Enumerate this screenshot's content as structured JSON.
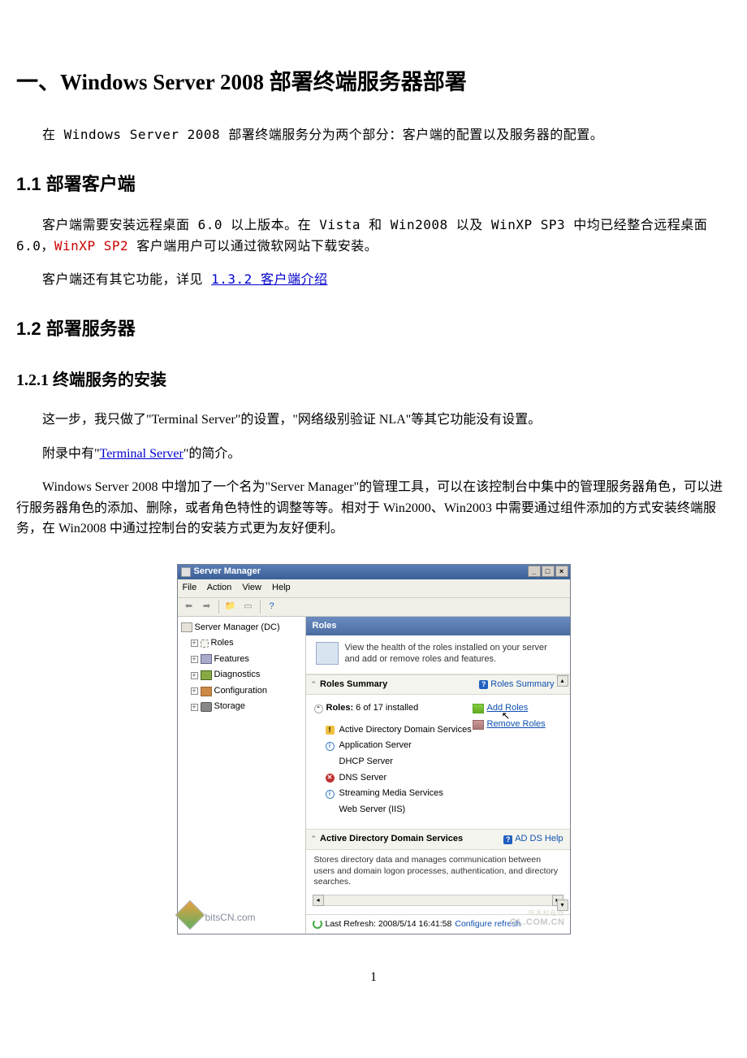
{
  "doc": {
    "h1_prefix": "一、",
    "h1_sans": "Windows Server 2008 ",
    "h1_suffix": "部署终端服务器部署",
    "intro": "在 Windows Server 2008 部署终端服务分为两个部分：客户端的配置以及服务器的配置。",
    "h2_1": "1.1 部署客户端",
    "p1a": "客户端需要安装远程桌面 6.0 以上版本。在 Vista 和 Win2008 以及 WinXP SP3 中均已经整合远程桌面 6.0，",
    "p1_red": "WinXP SP2",
    "p1b": " 客户端用户可以通过微软网站下载安装。",
    "p2a": "客户端还有其它功能，详见 ",
    "p2_link": "1.3.2 客户端介绍",
    "h2_2": "1.2 部署服务器",
    "h3_1": "1.2.1 终端服务的安装",
    "p3": "这一步，我只做了\"Terminal Server\"的设置，\"网络级别验证 NLA\"等其它功能没有设置。",
    "p4a": "附录中有\"",
    "p4_link": "Terminal Server",
    "p4b": "\"的简介。",
    "p5": "Windows Server 2008 中增加了一个名为\"Server Manager\"的管理工具，可以在该控制台中集中的管理服务器角色，可以进行服务器角色的添加、删除，或者角色特性的调整等等。相对于 Win2000、Win2003 中需要通过组件添加的方式安装终端服务，在 Win2008 中通过控制台的安装方式更为友好便利。",
    "page_num": "1"
  },
  "sm": {
    "title": "Server Manager",
    "menu": {
      "file": "File",
      "action": "Action",
      "view": "View",
      "help": "Help"
    },
    "tree": {
      "root": "Server Manager (DC)",
      "roles": "Roles",
      "features": "Features",
      "diagnostics": "Diagnostics",
      "configuration": "Configuration",
      "storage": "Storage"
    },
    "header": "Roles",
    "desc": "View the health of the roles installed on your server and add or remove roles and features.",
    "summary_hdr": "Roles Summary",
    "summary_help": "Roles Summary H",
    "roles_label": "Roles:",
    "roles_count": " 6 of 17 installed",
    "roles_list": {
      "r0": "Active Directory Domain Services",
      "r1": "Application Server",
      "r2": "DHCP Server",
      "r3": "DNS Server",
      "r4": "Streaming Media Services",
      "r5": "Web Server (IIS)"
    },
    "add_roles": "Add Roles",
    "remove_roles": "Remove Roles",
    "adds_hdr": "Active Directory Domain Services",
    "adds_help": "AD DS Help",
    "adds_text": "Stores directory data and manages communication between users and domain logon processes, authentication, and directory searches.",
    "status_prefix": "Last Refresh: 2008/5/14 16:41:58  ",
    "status_link": "Configure refresh",
    "wm_left": "bitsCN.com",
    "wm_right1": "OL.COM.CN",
    "wm_right2": "中关村在线"
  }
}
